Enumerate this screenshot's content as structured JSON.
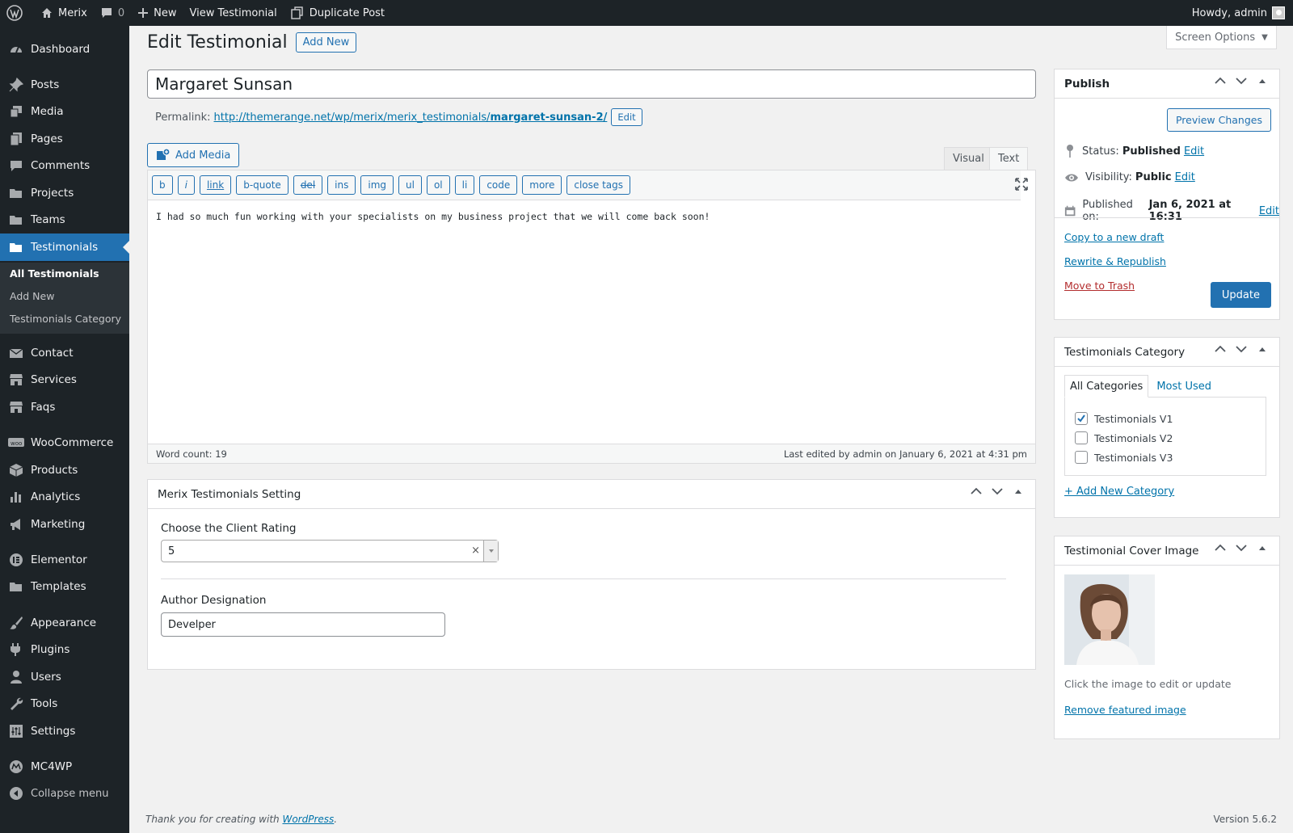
{
  "adminbar": {
    "site_name": "Merix",
    "comments_count": "0",
    "new_label": "New",
    "view_label": "View Testimonial",
    "duplicate_label": "Duplicate Post",
    "howdy": "Howdy, admin"
  },
  "sidebar": {
    "items": [
      {
        "label": "Dashboard",
        "icon": "dashboard-icon"
      },
      {
        "label": "Posts",
        "icon": "pin-icon"
      },
      {
        "label": "Media",
        "icon": "media-icon"
      },
      {
        "label": "Pages",
        "icon": "pages-icon"
      },
      {
        "label": "Comments",
        "icon": "comment-icon"
      },
      {
        "label": "Projects",
        "icon": "folder-icon"
      },
      {
        "label": "Teams",
        "icon": "folder-icon"
      },
      {
        "label": "Testimonials",
        "icon": "folder-icon"
      },
      {
        "label": "Contact",
        "icon": "mail-icon"
      },
      {
        "label": "Services",
        "icon": "store-icon"
      },
      {
        "label": "Faqs",
        "icon": "store-icon"
      },
      {
        "label": "WooCommerce",
        "icon": "woo-icon"
      },
      {
        "label": "Products",
        "icon": "box-icon"
      },
      {
        "label": "Analytics",
        "icon": "chart-bar-icon"
      },
      {
        "label": "Marketing",
        "icon": "megaphone-icon"
      },
      {
        "label": "Elementor",
        "icon": "elementor-icon"
      },
      {
        "label": "Templates",
        "icon": "folder-icon"
      },
      {
        "label": "Appearance",
        "icon": "brush-icon"
      },
      {
        "label": "Plugins",
        "icon": "plugin-icon"
      },
      {
        "label": "Users",
        "icon": "user-icon"
      },
      {
        "label": "Tools",
        "icon": "wrench-icon"
      },
      {
        "label": "Settings",
        "icon": "settings-icon"
      },
      {
        "label": "MC4WP",
        "icon": "mc4wp-icon"
      },
      {
        "label": "Collapse menu",
        "icon": "collapse-icon"
      }
    ],
    "submenu": [
      "All Testimonials",
      "Add New",
      "Testimonials Category"
    ]
  },
  "page": {
    "title": "Edit Testimonial",
    "add_new": "Add New",
    "screen_options": "Screen Options",
    "post_title": "Margaret Sunsan",
    "permalink_label": "Permalink:",
    "permalink_base": "http://themerange.net/wp/merix/merix_testimonials/",
    "permalink_slug": "margaret-sunsan-2/",
    "permalink_edit": "Edit"
  },
  "editor": {
    "add_media": "Add Media",
    "tab_visual": "Visual",
    "tab_text": "Text",
    "buttons": [
      "b",
      "i",
      "link",
      "b-quote",
      "del",
      "ins",
      "img",
      "ul",
      "ol",
      "li",
      "code",
      "more",
      "close tags"
    ],
    "content": "I had so much fun working with your specialists on my business project that we will come back soon!",
    "word_count": "Word count: 19",
    "last_edited": "Last edited by admin on January 6, 2021 at 4:31 pm"
  },
  "settings_box": {
    "title": "Merix Testimonials Setting",
    "rating_label": "Choose the Client Rating",
    "rating_value": "5",
    "designation_label": "Author Designation",
    "designation_value": "Develper"
  },
  "publish": {
    "title": "Publish",
    "preview": "Preview Changes",
    "status_label": "Status:",
    "status_value": "Published",
    "visibility_label": "Visibility:",
    "visibility_value": "Public",
    "published_label": "Published on:",
    "published_value": "Jan 6, 2021 at 16:31",
    "edit": "Edit",
    "copy_draft": "Copy to a new draft",
    "rewrite": "Rewrite & Republish",
    "trash": "Move to Trash",
    "update": "Update"
  },
  "category_box": {
    "title": "Testimonials Category",
    "tab_all": "All Categories",
    "tab_most": "Most Used",
    "items": [
      {
        "label": "Testimonials V1",
        "checked": true
      },
      {
        "label": "Testimonials V2",
        "checked": false
      },
      {
        "label": "Testimonials V3",
        "checked": false
      }
    ],
    "add_new": "+ Add New Category"
  },
  "cover_box": {
    "title": "Testimonial Cover Image",
    "hint": "Click the image to edit or update",
    "remove": "Remove featured image"
  },
  "footer": {
    "thanks_prefix": "Thank you for creating with",
    "wordpress": "WordPress",
    "thanks_suffix": ".",
    "version": "Version 5.6.2"
  },
  "colors": {
    "accent": "#2271b1",
    "admin_dark": "#1d2327",
    "trash": "#b32d2e"
  }
}
